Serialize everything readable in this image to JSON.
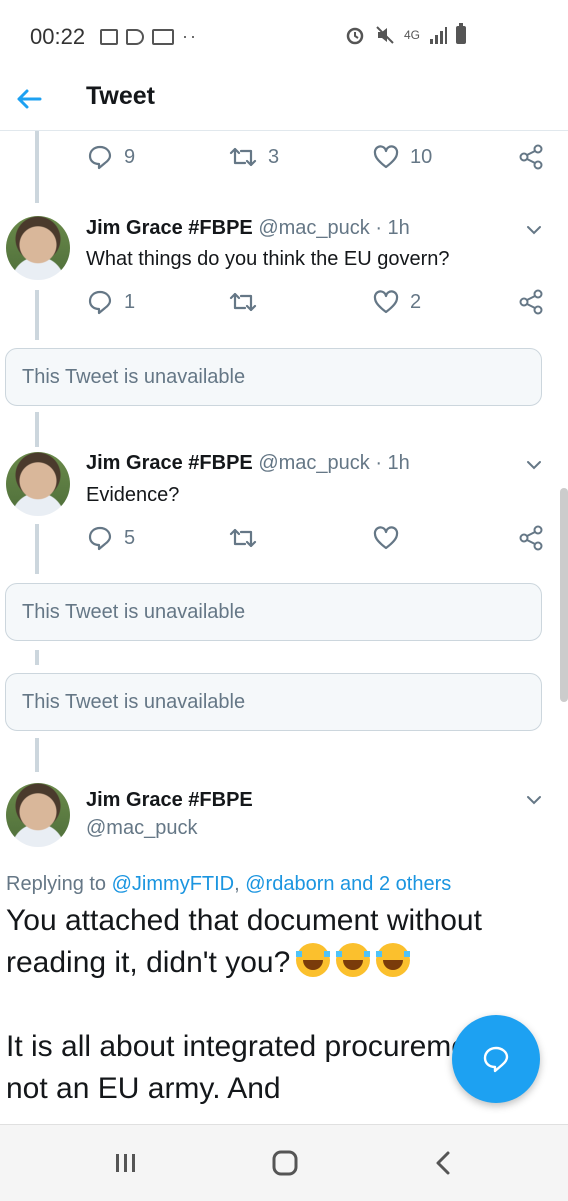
{
  "status_bar": {
    "time": "00:22",
    "network": "4G"
  },
  "header": {
    "title": "Tweet"
  },
  "top_actions": {
    "reply_count": "9",
    "retweet_count": "3",
    "like_count": "10"
  },
  "tweets": [
    {
      "name": "Jim Grace #FBPE",
      "handle": "@mac_puck",
      "time": "· 1h",
      "text": "What things do you think the EU govern?",
      "reply_count": "1",
      "retweet_count": "",
      "like_count": "2"
    },
    {
      "name": "Jim Grace #FBPE",
      "handle": "@mac_puck",
      "time": "· 1h",
      "text": "Evidence?",
      "reply_count": "5",
      "retweet_count": "",
      "like_count": ""
    }
  ],
  "unavailable_label": "This Tweet is unavailable",
  "main_tweet": {
    "name": "Jim Grace #FBPE",
    "handle": "@mac_puck",
    "replying_prefix": "Replying to ",
    "replying_user1": "@JimmyFTID",
    "replying_sep": ", ",
    "replying_user2": "@rdaborn and 2 others",
    "text_line1": "You attached that document without reading it, didn't you?",
    "text_line2": "It is all about integrated procurement, not an EU army. And"
  },
  "colors": {
    "accent": "#1da1f2",
    "link": "#1b95e0",
    "secondary_text": "#657786",
    "divider": "#ccd6dd"
  },
  "icons": {
    "back": "arrow-left-icon",
    "reply": "reply-icon",
    "retweet": "retweet-icon",
    "like": "heart-icon",
    "share": "share-icon",
    "more": "chevron-down-icon",
    "compose": "compose-reply-icon",
    "recents": "recents-icon",
    "home": "home-icon",
    "nav_back": "nav-back-icon"
  }
}
